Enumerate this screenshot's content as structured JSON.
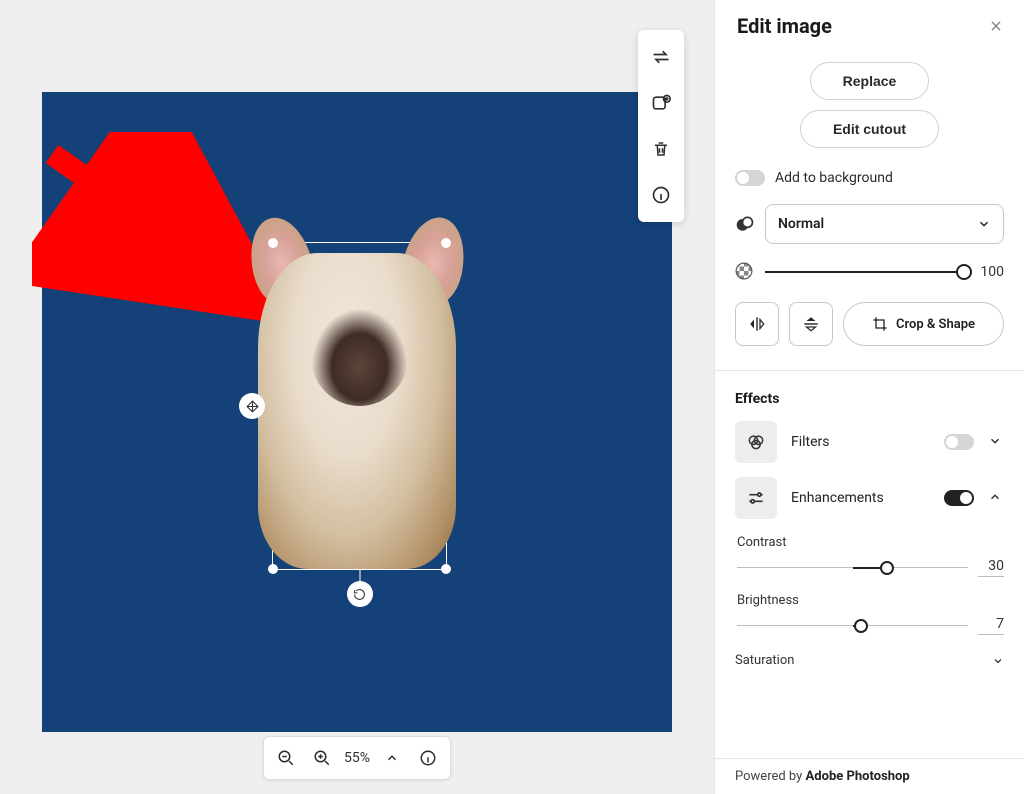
{
  "panel": {
    "title": "Edit image",
    "buttons": {
      "replace": "Replace",
      "edit_cutout": "Edit cutout",
      "crop_shape": "Crop & Shape"
    },
    "add_to_background_label": "Add to background",
    "add_to_background_on": false,
    "blend_mode": "Normal",
    "opacity_value": 100,
    "effects_title": "Effects",
    "filters": {
      "label": "Filters",
      "on": false
    },
    "enhancements": {
      "label": "Enhancements",
      "on": true,
      "contrast_label": "Contrast",
      "contrast_value": 30,
      "brightness_label": "Brightness",
      "brightness_value": 7,
      "saturation_label": "Saturation"
    },
    "footer_prefix": "Powered by ",
    "footer_brand": "Adobe Photoshop"
  },
  "zoom": {
    "percent": "55%"
  },
  "icons": {
    "swap": "swap-horizontal-icon",
    "add_image": "add-image-icon",
    "trash": "trash-icon",
    "info": "info-icon",
    "zoom_out": "zoom-out-icon",
    "zoom_in": "zoom-in-icon",
    "chevron_up": "chevron-up-icon",
    "chevron_down": "chevron-down-icon",
    "close": "close-icon",
    "opacity": "opacity-icon",
    "flip_h": "flip-horizontal-icon",
    "flip_v": "flip-vertical-icon",
    "crop": "crop-icon",
    "filters": "filters-icon",
    "adjust": "adjust-icon",
    "move": "move-icon",
    "rotate": "rotate-icon",
    "blend_shape": "blend-mode-icon",
    "arrow": "annotation-arrow"
  },
  "canvas": {
    "bg_color": "#144178",
    "selection": "dog-cutout"
  }
}
